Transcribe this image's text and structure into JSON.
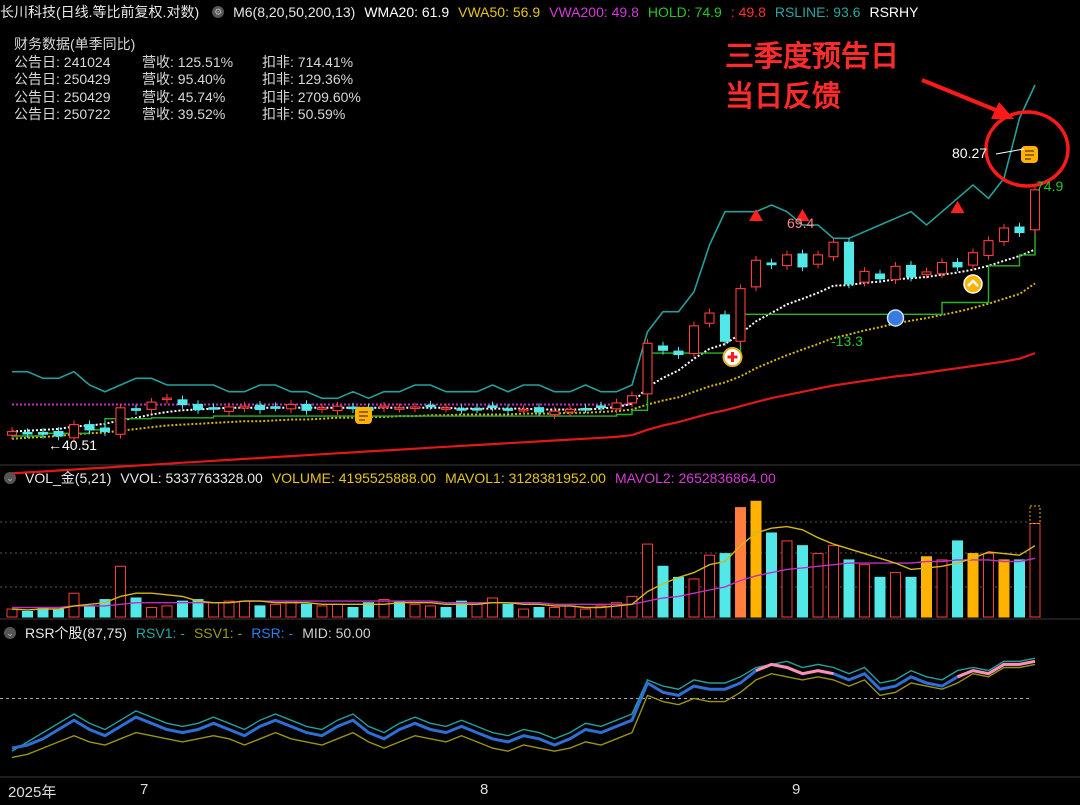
{
  "title_bar": {
    "stock": "长川科技(日线.等比前复权.对数)",
    "indicator": "M6(8,20,50,200,13)",
    "items": [
      {
        "label": "WMA20: 61.9",
        "color": "#ffffff"
      },
      {
        "label": "VWA50: 56.9",
        "color": "#e6c619"
      },
      {
        "label": "VWA200: 49.8",
        "color": "#d43bd4"
      },
      {
        "label": "HOLD: 74.9",
        "color": "#29c529"
      },
      {
        "label": ": 49.8",
        "color": "#ff3030"
      },
      {
        "label": "RSLINE: 93.6",
        "color": "#2aa6a0"
      },
      {
        "label": "RSRHY",
        "color": "#ffffff"
      }
    ]
  },
  "financial": {
    "title": "财务数据(单季同比)",
    "rows": [
      {
        "date": "公告日: 241024",
        "rev": "营收: 125.51%",
        "np": "扣非: 714.41%"
      },
      {
        "date": "公告日: 250429",
        "rev": "营收: 95.40%",
        "np": "扣非: 129.36%"
      },
      {
        "date": "公告日: 250429",
        "rev": "营收: 45.74%",
        "np": "扣非: 2709.60%"
      },
      {
        "date": "公告日: 250722",
        "rev": "营收: 39.52%",
        "np": "扣非: 50.59%"
      }
    ]
  },
  "annotation": {
    "line1": "三季度预告日",
    "line2": "当日反馈"
  },
  "price_labels": {
    "low": "40.51",
    "high": "69.4",
    "neg": "-13.3",
    "last": "80.27",
    "hold": "74.9"
  },
  "volume_bar": {
    "title": "VOL_金(5,21)",
    "items": [
      {
        "label": "VVOL: 5337763328.00",
        "color": "#e8e8e8"
      },
      {
        "label": "VOLUME: 4195525888.00",
        "color": "#e6c619"
      },
      {
        "label": "MAVOL1: 3128381952.00",
        "color": "#e6c619"
      },
      {
        "label": "MAVOL2: 2652836864.00",
        "color": "#d43bd4"
      }
    ]
  },
  "rsr_bar": {
    "title": "RSR个股(87,75)",
    "items": [
      {
        "label": "RSV1: -",
        "color": "#2aa6a0"
      },
      {
        "label": "SSV1: -",
        "color": "#a09a20"
      },
      {
        "label": "RSR: -",
        "color": "#2e7fe6"
      },
      {
        "label": "MID: 50.00",
        "color": "#cfcfcf"
      }
    ]
  },
  "x_axis": {
    "labels": [
      "2025年",
      "7",
      "8",
      "9"
    ]
  },
  "chart_data": {
    "type": "candlestick",
    "bars": 67,
    "price": {
      "close": [
        41.0,
        40.8,
        40.7,
        40.5,
        41.8,
        41.2,
        41.0,
        43.8,
        43.5,
        44.5,
        45.0,
        44.2,
        43.6,
        43.7,
        43.9,
        44.0,
        43.6,
        43.9,
        44.2,
        43.5,
        43.8,
        44.0,
        43.7,
        43.5,
        44.0,
        43.8,
        43.9,
        44.1,
        43.8,
        43.6,
        43.7,
        43.9,
        43.5,
        43.6,
        43.3,
        43.4,
        43.6,
        43.7,
        43.9,
        44.4,
        45.3,
        52.4,
        51.4,
        50.8,
        55.0,
        57.0,
        52.7,
        61.0,
        66.0,
        65.2,
        67.0,
        64.8,
        67.0,
        69.4,
        61.8,
        64.0,
        62.7,
        64.9,
        63.0,
        63.9,
        65.6,
        64.8,
        67.4,
        69.7,
        72.2,
        71.3,
        80.27
      ],
      "hold_level": [
        40.5,
        40.5,
        40.8,
        40.8,
        40.8,
        41.2,
        42.5,
        42.5,
        42.5,
        42.6,
        42.6,
        42.6,
        42.6,
        42.8,
        42.8,
        42.8,
        42.8,
        42.8,
        42.8,
        42.8,
        42.8,
        42.8,
        42.8,
        42.8,
        42.8,
        42.8,
        42.8,
        42.8,
        42.8,
        42.8,
        42.8,
        42.8,
        42.8,
        42.8,
        42.8,
        42.8,
        42.8,
        42.8,
        42.8,
        43.0,
        43.5,
        51.0,
        51.0,
        51.0,
        51.0,
        51.0,
        51.0,
        56.8,
        56.8,
        56.8,
        56.8,
        56.8,
        56.8,
        56.8,
        56.8,
        56.8,
        56.8,
        56.8,
        56.8,
        56.8,
        58.7,
        58.7,
        58.7,
        65.0,
        65.0,
        67.0,
        74.9
      ],
      "rsline": [
        66,
        66,
        65,
        65,
        66,
        64,
        63,
        64,
        65,
        65,
        64,
        64,
        64,
        64,
        63,
        63,
        64,
        64,
        63,
        63,
        62,
        62,
        63,
        62,
        63,
        63,
        64,
        64,
        63,
        63,
        63,
        64,
        63,
        64,
        64,
        63,
        63,
        64,
        63,
        63,
        64,
        72,
        75,
        75,
        78,
        85,
        90,
        90,
        90,
        91,
        90,
        88,
        88,
        86,
        86,
        87,
        88,
        89,
        90,
        88,
        90,
        92,
        94,
        92,
        95,
        104,
        109
      ],
      "ma_white": [
        41.0,
        41.1,
        41.2,
        41.3,
        41.6,
        41.7,
        41.9,
        42.3,
        42.6,
        43.0,
        43.3,
        43.5,
        43.6,
        43.7,
        43.8,
        43.8,
        43.8,
        43.8,
        43.8,
        43.8,
        43.8,
        43.8,
        43.8,
        43.8,
        43.8,
        43.8,
        43.8,
        43.8,
        43.8,
        43.7,
        43.7,
        43.7,
        43.7,
        43.7,
        43.6,
        43.6,
        43.6,
        43.6,
        43.7,
        43.9,
        44.3,
        46.4,
        47.6,
        48.6,
        50.2,
        51.6,
        52.3,
        53.8,
        55.7,
        57.0,
        58.4,
        59.3,
        60.3,
        61.5,
        61.6,
        62.0,
        62.2,
        62.6,
        62.8,
        63.0,
        63.4,
        63.8,
        64.3,
        65.0,
        65.9,
        66.8,
        68.0
      ],
      "ma_yellow": [
        40.2,
        40.3,
        40.4,
        40.5,
        40.7,
        40.8,
        40.9,
        41.1,
        41.3,
        41.5,
        41.7,
        41.8,
        41.9,
        42.0,
        42.1,
        42.2,
        42.2,
        42.3,
        42.4,
        42.4,
        42.5,
        42.6,
        42.6,
        42.7,
        42.7,
        42.8,
        42.8,
        42.9,
        42.9,
        43.0,
        43.0,
        43.0,
        43.0,
        43.1,
        43.1,
        43.1,
        43.2,
        43.2,
        43.3,
        43.4,
        43.6,
        44.2,
        44.7,
        45.1,
        45.8,
        46.5,
        47.0,
        47.8,
        48.9,
        49.8,
        50.7,
        51.5,
        52.3,
        53.2,
        53.7,
        54.3,
        54.8,
        55.4,
        55.8,
        56.2,
        56.7,
        57.2,
        57.8,
        58.5,
        59.3,
        60.1,
        61.9
      ],
      "ma_red": [
        36.5,
        36.6,
        36.7,
        36.8,
        36.9,
        37.0,
        37.1,
        37.2,
        37.3,
        37.4,
        37.5,
        37.6,
        37.7,
        37.8,
        37.9,
        38.0,
        38.1,
        38.2,
        38.3,
        38.4,
        38.5,
        38.6,
        38.7,
        38.8,
        38.9,
        39.0,
        39.1,
        39.2,
        39.3,
        39.4,
        39.5,
        39.6,
        39.7,
        39.8,
        39.9,
        40.0,
        40.1,
        40.2,
        40.3,
        40.4,
        40.6,
        41.2,
        41.7,
        42.1,
        42.6,
        43.1,
        43.5,
        44.0,
        44.5,
        45.0,
        45.4,
        45.8,
        46.2,
        46.6,
        46.9,
        47.2,
        47.5,
        47.8,
        48.0,
        48.3,
        48.6,
        48.9,
        49.2,
        49.5,
        49.8,
        50.2,
        51.0
      ],
      "ma_purple": [
        44.2,
        44.2,
        44.2,
        44.2,
        44.2,
        44.2,
        44.2,
        44.2,
        44.2,
        44.2,
        44.2,
        44.2,
        44.2,
        44.2,
        44.2,
        44.2,
        44.2,
        44.2,
        44.2,
        44.2,
        44.2,
        44.2,
        44.2,
        44.2,
        44.2,
        44.2,
        44.2,
        44.2,
        44.2,
        44.2,
        44.2,
        44.2,
        44.2,
        44.2,
        44.2,
        44.2,
        44.2,
        44.2,
        44.2,
        44.2,
        44.2,
        null,
        null,
        null,
        null,
        null,
        null,
        null,
        null,
        null,
        null,
        null,
        null,
        null,
        null,
        null,
        null,
        null,
        null,
        null,
        null,
        null,
        null,
        null,
        null,
        null,
        null
      ]
    },
    "volume": {
      "values": [
        0.5,
        0.35,
        0.6,
        0.5,
        1.5,
        0.7,
        1.1,
        3.2,
        1.2,
        0.6,
        0.7,
        1.0,
        1.1,
        0.9,
        1.0,
        1.0,
        0.7,
        0.8,
        1.0,
        0.8,
        0.7,
        0.8,
        0.6,
        0.9,
        1.1,
        1.0,
        0.8,
        0.7,
        0.6,
        1.0,
        0.8,
        1.2,
        0.8,
        0.5,
        0.6,
        0.6,
        0.7,
        0.5,
        0.7,
        0.9,
        1.3,
        4.6,
        3.2,
        2.5,
        2.4,
        3.9,
        4.0,
        6.9,
        7.3,
        5.3,
        4.8,
        4.5,
        4.0,
        4.5,
        3.6,
        3.3,
        2.5,
        2.8,
        2.5,
        3.8,
        3.6,
        4.8,
        4.0,
        4.0,
        3.6,
        3.6,
        5.9
      ],
      "mavol1": [
        0.5,
        0.45,
        0.5,
        0.5,
        0.7,
        0.8,
        0.9,
        1.3,
        1.5,
        1.5,
        1.4,
        1.3,
        1.0,
        0.9,
        0.9,
        1.0,
        1.0,
        0.9,
        0.9,
        0.9,
        0.8,
        0.8,
        0.8,
        0.8,
        0.8,
        0.9,
        0.9,
        0.9,
        0.8,
        0.8,
        0.8,
        0.9,
        0.9,
        0.8,
        0.8,
        0.7,
        0.7,
        0.6,
        0.6,
        0.7,
        0.8,
        1.6,
        2.1,
        2.5,
        2.8,
        3.3,
        3.5,
        4.5,
        5.3,
        5.6,
        5.7,
        5.5,
        5.0,
        4.6,
        4.3,
        4.0,
        3.7,
        3.4,
        3.0,
        3.1,
        3.2,
        3.4,
        3.7,
        4.1,
        4.0,
        3.9,
        4.5
      ],
      "mavol2": [
        0.6,
        0.6,
        0.6,
        0.6,
        0.7,
        0.7,
        0.7,
        0.8,
        0.9,
        0.9,
        0.9,
        0.9,
        0.9,
        0.9,
        0.9,
        1.0,
        1.0,
        1.0,
        1.0,
        1.0,
        1.0,
        1.0,
        1.0,
        1.0,
        1.0,
        1.0,
        1.0,
        1.0,
        0.9,
        0.9,
        0.9,
        0.9,
        0.9,
        0.9,
        0.9,
        0.8,
        0.8,
        0.8,
        0.8,
        0.8,
        0.8,
        1.0,
        1.2,
        1.3,
        1.5,
        1.7,
        1.9,
        2.3,
        2.6,
        2.8,
        3.0,
        3.1,
        3.2,
        3.3,
        3.4,
        3.4,
        3.4,
        3.4,
        3.4,
        3.5,
        3.5,
        3.6,
        3.6,
        3.6,
        3.5,
        3.5,
        3.7
      ]
    },
    "rsr": {
      "rsr": [
        18,
        20,
        24,
        30,
        36,
        30,
        26,
        32,
        38,
        34,
        30,
        28,
        30,
        34,
        30,
        26,
        32,
        36,
        32,
        28,
        26,
        32,
        36,
        28,
        24,
        30,
        34,
        30,
        28,
        32,
        28,
        24,
        22,
        26,
        24,
        20,
        24,
        30,
        28,
        32,
        36,
        60,
        54,
        52,
        58,
        56,
        56,
        60,
        68,
        72,
        70,
        66,
        68,
        66,
        62,
        66,
        56,
        58,
        64,
        60,
        58,
        64,
        68,
        66,
        72,
        72,
        74
      ],
      "rsv1": [
        16,
        22,
        28,
        34,
        40,
        34,
        30,
        36,
        42,
        38,
        34,
        32,
        34,
        38,
        34,
        30,
        36,
        40,
        36,
        32,
        30,
        36,
        40,
        32,
        28,
        34,
        38,
        34,
        32,
        36,
        32,
        28,
        26,
        30,
        28,
        24,
        28,
        34,
        32,
        36,
        40,
        62,
        58,
        56,
        62,
        60,
        60,
        64,
        70,
        72,
        74,
        70,
        72,
        70,
        66,
        70,
        60,
        62,
        68,
        64,
        62,
        68,
        70,
        68,
        74,
        74,
        76
      ],
      "ssv1": [
        12,
        14,
        18,
        22,
        26,
        22,
        20,
        24,
        28,
        26,
        24,
        22,
        24,
        26,
        24,
        20,
        24,
        28,
        24,
        22,
        20,
        24,
        28,
        22,
        18,
        22,
        26,
        24,
        22,
        26,
        22,
        18,
        16,
        20,
        18,
        16,
        18,
        22,
        20,
        24,
        28,
        52,
        48,
        46,
        50,
        48,
        48,
        54,
        62,
        66,
        64,
        62,
        64,
        62,
        58,
        62,
        52,
        54,
        60,
        58,
        56,
        60,
        66,
        64,
        70,
        70,
        72
      ],
      "mid": 50
    }
  }
}
